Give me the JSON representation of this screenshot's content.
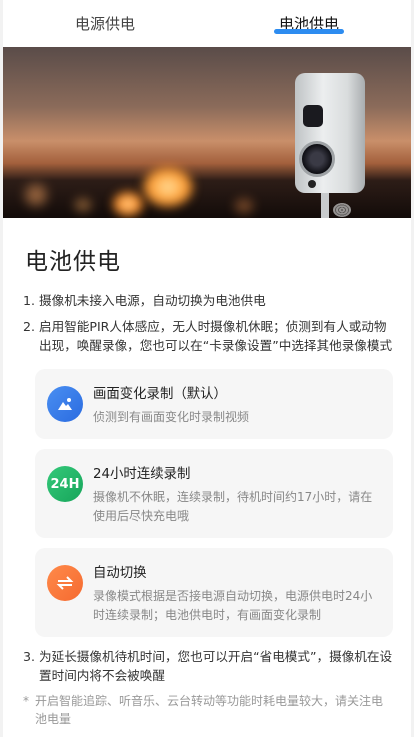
{
  "tabs": [
    {
      "label": "电源供电",
      "active": false
    },
    {
      "label": "电池供电",
      "active": true
    }
  ],
  "title": "电池供电",
  "steps": [
    {
      "num": "1.",
      "text": "摄像机未接入电源，自动切换为电池供电"
    },
    {
      "num": "2.",
      "text": "启用智能PIR人体感应，无人时摄像机休眠；侦测到有人或动物出现，唤醒录像，您也可以在“卡录像设置”中选择其他录像模式"
    },
    {
      "num": "3.",
      "text": "为延长摄像机待机时间，您也可以开启“省电模式”，摄像机在设置时间内将不会被唤醒"
    }
  ],
  "cards": [
    {
      "title": "画面变化录制（默认）",
      "desc": "侦测到有画面变化时录制视频",
      "icon": "image-icon",
      "color": "#3a7ff0"
    },
    {
      "title": "24小时连续录制",
      "desc": "摄像机不休眠，连续录制，待机时间约17小时，请在使用后尽快充电哦",
      "icon": "24h-icon",
      "icon_text": "24H",
      "color": "#22b868"
    },
    {
      "title": "自动切换",
      "desc": "录像模式根据是否接电源自动切换，电源供电时24小时连续录制；电池供电时，有画面变化录制",
      "icon": "switch-icon",
      "color": "#f77a3a"
    }
  ],
  "note": {
    "mark": "*",
    "text": "开启智能追踪、听音乐、云台转动等功能时耗电量较大，请关注电池电量"
  },
  "colors": {
    "accent": "#2d8cf0"
  }
}
